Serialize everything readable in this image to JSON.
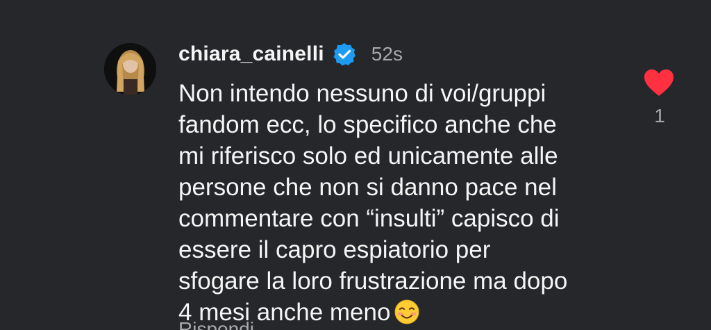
{
  "comment": {
    "username": "chiara_cainelli",
    "verified_icon": "verified-badge-icon",
    "timestamp": "52s",
    "text": "Non intendo nessuno di voi/gruppi\nfandom ecc, lo specifico anche che\nmi riferisco solo ed unicamente alle\npersone che non si danno pace nel\ncommentare con “insulti” capisco di\nessere il capro espiatorio per\nsfogare la loro frustrazione ma dopo\n4 mesi anche meno",
    "emoji": "smiling-face-emoji",
    "like_icon": "heart-icon",
    "like_count": "1",
    "reply_label": "Rispondi"
  },
  "colors": {
    "background": "#26272b",
    "like_red": "#ff3040",
    "verified_blue": "#1d9bf0",
    "muted": "#a8a8ad"
  }
}
